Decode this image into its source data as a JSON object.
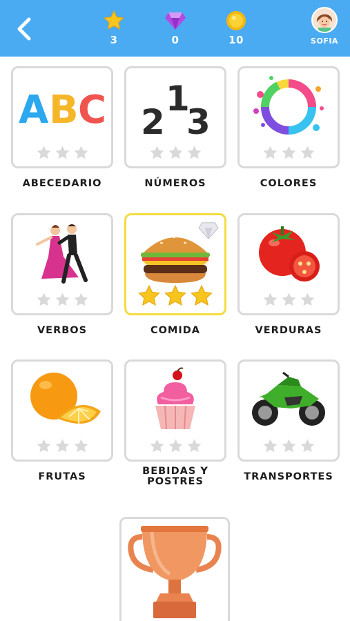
{
  "header": {
    "back_icon": "chevron-left-icon",
    "stars": {
      "icon": "star-icon",
      "value": "3"
    },
    "gems": {
      "icon": "diamond-icon",
      "value": "0"
    },
    "coins": {
      "icon": "coin-icon",
      "value": "10"
    },
    "profile_name": "SOFIA",
    "bg_color": "#4aabf2"
  },
  "categories": [
    {
      "label": "ABECEDARIO",
      "icon": "abc-letters-icon",
      "stars_earned": 0
    },
    {
      "label": "NÚMEROS",
      "icon": "numbers-icon",
      "stars_earned": 0
    },
    {
      "label": "COLORES",
      "icon": "paint-splash-icon",
      "stars_earned": 0
    },
    {
      "label": "VERBOS",
      "icon": "dancing-couple-icon",
      "stars_earned": 0
    },
    {
      "label": "COMIDA",
      "icon": "hamburger-icon",
      "stars_earned": 3,
      "selected": true,
      "badge": "diamond-icon"
    },
    {
      "label": "VERDURAS",
      "icon": "tomato-icon",
      "stars_earned": 0
    },
    {
      "label": "FRUTAS",
      "icon": "orange-icon",
      "stars_earned": 0
    },
    {
      "label": "BEBIDAS Y POSTRES",
      "icon": "cupcake-icon",
      "stars_earned": 0
    },
    {
      "label": "TRANSPORTES",
      "icon": "motorcycle-icon",
      "stars_earned": 0
    }
  ],
  "trophy": {
    "icon": "trophy-icon"
  },
  "abc_letters": [
    "A",
    "B",
    "C"
  ],
  "number_digits": [
    "2",
    "1",
    "3"
  ],
  "colors": {
    "active_border": "#f4dc3f",
    "star_earned": "#f7c51e",
    "star_empty": "#d9d9d9"
  }
}
